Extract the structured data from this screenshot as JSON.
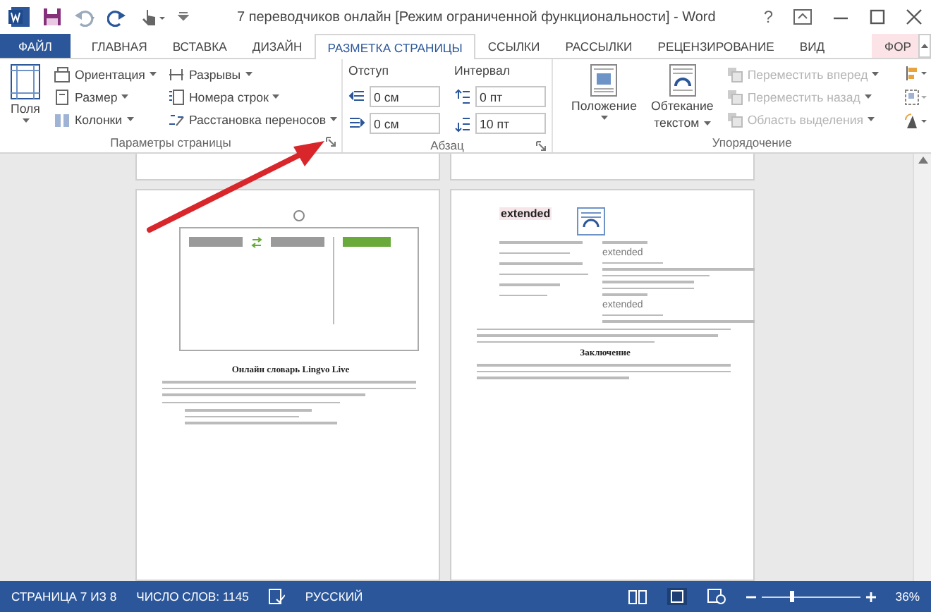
{
  "window": {
    "title": "7 переводчиков онлайн [Режим ограниченной функциональности] - Word",
    "help": "?"
  },
  "tabs": [
    {
      "label": "ФАЙЛ",
      "kind": "file",
      "selected": false
    },
    {
      "label": "ГЛАВНАЯ",
      "kind": "tab",
      "selected": false
    },
    {
      "label": "ВСТАВКА",
      "kind": "tab",
      "selected": false
    },
    {
      "label": "ДИЗАЙН",
      "kind": "tab",
      "selected": false
    },
    {
      "label": "РАЗМЕТКА СТРАНИЦЫ",
      "kind": "tab",
      "selected": true
    },
    {
      "label": "ССЫЛКИ",
      "kind": "tab",
      "selected": false
    },
    {
      "label": "РАССЫЛКИ",
      "kind": "tab",
      "selected": false
    },
    {
      "label": "РЕЦЕНЗИРОВАНИЕ",
      "kind": "tab",
      "selected": false
    },
    {
      "label": "ВИД",
      "kind": "tab",
      "selected": false
    },
    {
      "label": "ФОР",
      "kind": "context",
      "selected": false
    }
  ],
  "page_setup": {
    "label": "Параметры страницы",
    "margins": "Поля",
    "commands": [
      {
        "label": "Ориентация",
        "disabled": false
      },
      {
        "label": "Размер",
        "disabled": false
      },
      {
        "label": "Колонки",
        "disabled": false
      },
      {
        "label": "Разрывы",
        "disabled": false
      },
      {
        "label": "Номера строк",
        "disabled": false
      },
      {
        "label": "Расстановка переносов",
        "disabled": false
      }
    ]
  },
  "paragraph": {
    "label": "Абзац",
    "indent_label": "Отступ",
    "spacing_label": "Интервал",
    "indent_left": "0 см",
    "indent_right": "0 см",
    "spacing_before": "0 пт",
    "spacing_after": "10 пт"
  },
  "arrange": {
    "label": "Упорядочение",
    "position": "Положение",
    "wrap_line1": "Обтекание",
    "wrap_line2": "текстом",
    "commands": [
      {
        "label": "Переместить вперед",
        "disabled": true
      },
      {
        "label": "Переместить назад",
        "disabled": true
      },
      {
        "label": "Область выделения",
        "disabled": true
      }
    ]
  },
  "left_page": {
    "heading": "Онлайн словарь Lingvo Live"
  },
  "right_page": {
    "word": "extended",
    "entries": [
      "extended",
      "extended"
    ],
    "conclusion": "Заключение"
  },
  "status_bar": {
    "page": "СТРАНИЦА 7 ИЗ 8",
    "words": "ЧИСЛО СЛОВ: 1145",
    "language": "РУССКИЙ",
    "zoom": "36%",
    "zoom_level": {
      "level": 0.3
    }
  }
}
